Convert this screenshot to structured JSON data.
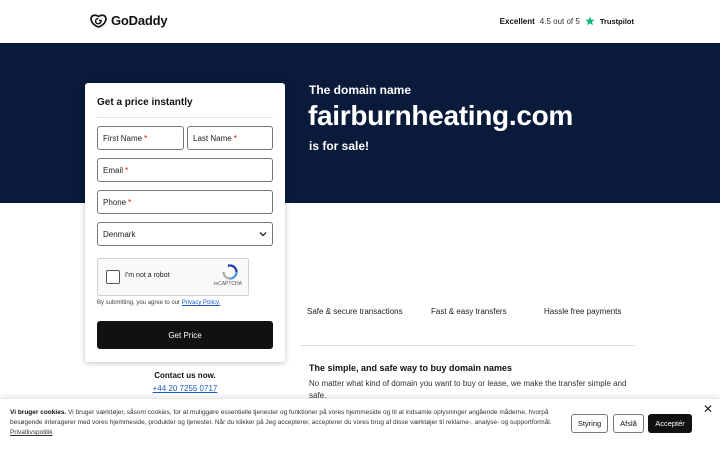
{
  "header": {
    "brand": "GoDaddy",
    "rating_word": "Excellent",
    "rating_score": "4.5 out of 5",
    "trustpilot": "Trustpilot"
  },
  "hero": {
    "pre": "The domain name",
    "domain": "fairburnheating.com",
    "post": "is for sale!"
  },
  "form": {
    "title": "Get a price instantly",
    "first_name": "First Name",
    "last_name": "Last Name",
    "email": "Email",
    "phone": "Phone",
    "required_mark": "*",
    "country": "Denmark",
    "captcha_label": "I'm not a robot",
    "captcha_brand": "reCAPTCHA",
    "consent_prefix": "By submitting, you agree to our",
    "privacy_link": "Privacy Policy.",
    "submit": "Get Price"
  },
  "contact": {
    "title": "Contact us now.",
    "phone": "+44 20 7255 0717"
  },
  "features": [
    "Safe & secure transactions",
    "Fast & easy transfers",
    "Hassle free payments"
  ],
  "info": {
    "title": "The simple, and safe way to buy domain names",
    "body": "No matter what kind of domain you want to buy or lease, we make the transfer simple and safe."
  },
  "cookie": {
    "heading": "Vi bruger cookies.",
    "text": "Vi bruger værktøjer, såsom cookies, for at muliggøre essentielle tjenester og funktioner på vores hjemmeside og til at indsamle oplysninger angående måderne, hvorpå besøgende interagerer med vores hjemmeside, produkter og tjenester. Når du klikker på Jeg accepterer, accepterer du vores brug af disse værktøjer til reklame-, analyse- og supportformål.",
    "policy_link": "Privatlivspolitik",
    "btn_manage": "Styring",
    "btn_decline": "Afslå",
    "btn_accept": "Acceptér"
  },
  "colors": {
    "hero_bg": "#0a1a3a",
    "button_bg": "#111111",
    "link": "#1a5bbf",
    "trustpilot_star": "#00b67a"
  }
}
